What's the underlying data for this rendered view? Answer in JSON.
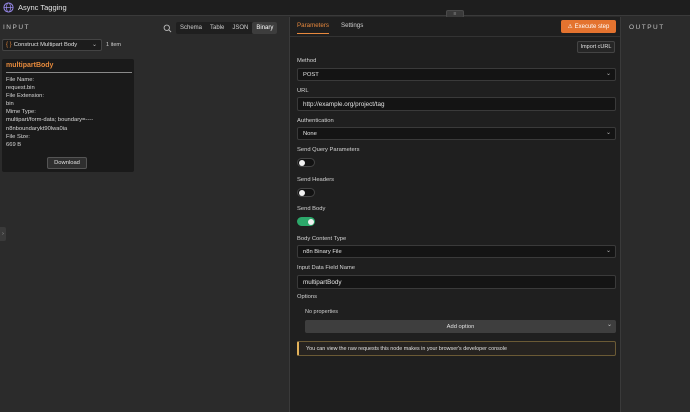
{
  "window": {
    "title": "Async Tagging"
  },
  "collapse_handle": {
    "glyph": "≡"
  },
  "input": {
    "title": "INPUT",
    "view_tabs": [
      "Schema",
      "Table",
      "JSON",
      "Binary"
    ],
    "active_view": "Binary",
    "node_select": {
      "brace": "{ }",
      "value": "Construct Multipart Body"
    },
    "item_count": "1 item",
    "binary": {
      "name": "multipartBody",
      "lines": [
        "File Name:",
        "request.bin",
        "File Extension:",
        "bin",
        "Mime Type:",
        "multipart/form-data; boundary=----",
        "n8nboundarykt90lwa0ia",
        "File Size:",
        "669 B"
      ],
      "download_label": "Download"
    }
  },
  "params": {
    "tabs": [
      "Parameters",
      "Settings"
    ],
    "active_tab": "Parameters",
    "execute_label": "Execute step",
    "import_curl_label": "Import cURL",
    "method": {
      "label": "Method",
      "value": "POST"
    },
    "url": {
      "label": "URL",
      "value": "http://example.org/project/tag"
    },
    "authentication": {
      "label": "Authentication",
      "value": "None"
    },
    "send_query": {
      "label": "Send Query Parameters",
      "on": false
    },
    "send_headers": {
      "label": "Send Headers",
      "on": false
    },
    "send_body": {
      "label": "Send Body",
      "on": true
    },
    "body_content_type": {
      "label": "Body Content Type",
      "value": "n8n Binary File"
    },
    "input_field": {
      "label": "Input Data Field Name",
      "value": "multipartBody"
    },
    "options": {
      "label": "Options",
      "empty_text": "No properties",
      "add_label": "Add option"
    },
    "notice": "You can view the raw requests this node makes in your browser's developer console"
  },
  "output": {
    "title": "OUTPUT"
  },
  "colors": {
    "accent": "#e4732f",
    "toggle_on": "#2ca86a",
    "notice_border": "#e3b25a"
  }
}
